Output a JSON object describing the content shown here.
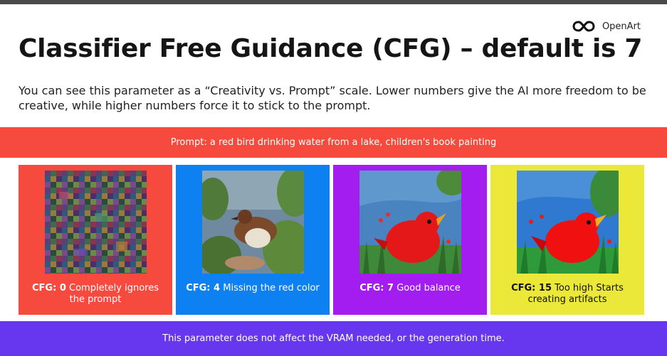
{
  "brand": {
    "name": "OpenArt",
    "icon": "infinity-logo-icon"
  },
  "title": "Classifier Free Guidance (CFG) – default is 7",
  "intro": "You can see this parameter as a “Creativity vs. Prompt” scale. Lower numbers give the AI more freedom to be creative, while higher numbers force it to stick to the prompt.",
  "prompt_banner": "Prompt: a red bird drinking water from a lake, children's book painting",
  "cards": [
    {
      "label": "CFG: 0",
      "desc": "Completely ignores the prompt",
      "bg": "#f64a3f",
      "text_color": "#ffffff"
    },
    {
      "label": "CFG: 4",
      "desc": "Missing the red color",
      "bg": "#0d80f2",
      "text_color": "#ffffff"
    },
    {
      "label": "CFG: 7",
      "desc": "Good balance",
      "bg": "#a41df0",
      "text_color": "#ffffff"
    },
    {
      "label": "CFG: 15",
      "desc": "Too high Starts creating artifacts",
      "bg": "#ece83a",
      "text_color": "#111111"
    }
  ],
  "footer": "This parameter does not affect the VRAM needed, or the generation time."
}
